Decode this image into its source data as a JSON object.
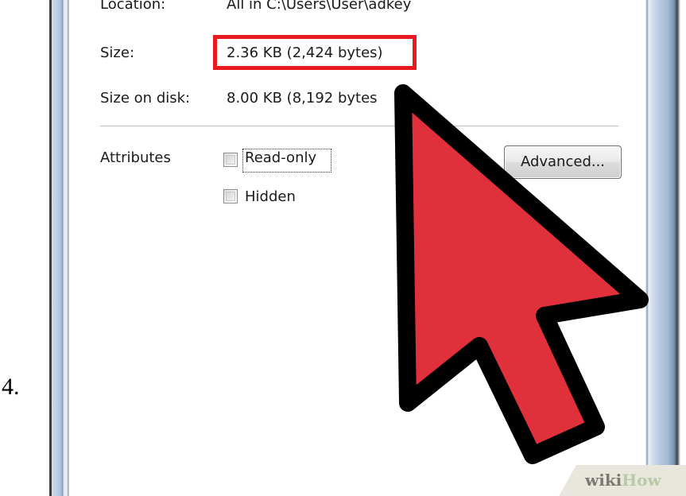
{
  "step": {
    "number": "4."
  },
  "properties": {
    "location_label": "Location:",
    "location_value": "All in C:\\Users\\User\\adkey",
    "size_label": "Size:",
    "size_value": "2.36 KB (2,424 bytes)",
    "size_on_disk_label": "Size on disk:",
    "size_on_disk_value": "8.00 KB (8,192 bytes"
  },
  "attributes": {
    "label": "Attributes",
    "read_only_label": "Read-only",
    "read_only_checked": false,
    "hidden_label": "Hidden",
    "hidden_checked": false,
    "advanced_button": "Advanced..."
  },
  "annotations": {
    "highlight_color": "#e8191f",
    "cursor_icon": "arrow-pointer-icon",
    "cursor_fill": "#e0303c",
    "cursor_outline": "#000000"
  },
  "watermark": {
    "wiki": "wiki",
    "how": "How"
  }
}
